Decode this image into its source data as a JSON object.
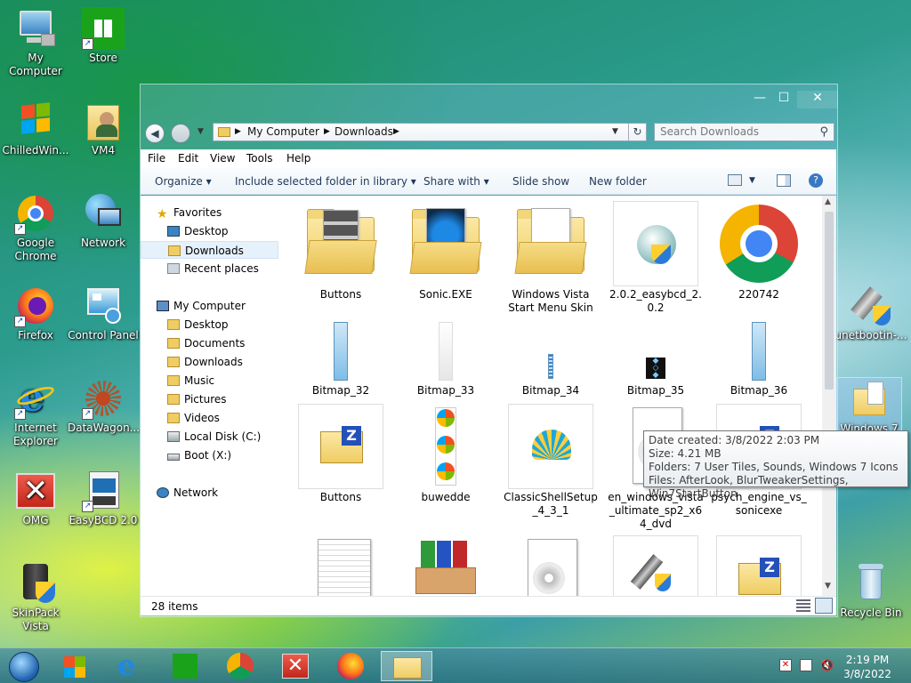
{
  "desktop": {
    "icons": [
      {
        "label": "My Computer",
        "icon": "computer-icon"
      },
      {
        "label": "Store",
        "icon": "store-icon"
      },
      {
        "label": "ChilledWin...",
        "icon": "windows-flag-icon"
      },
      {
        "label": "VM4",
        "icon": "user-folder-icon"
      },
      {
        "label": "Google Chrome",
        "icon": "chrome-icon"
      },
      {
        "label": "Network",
        "icon": "network-icon"
      },
      {
        "label": "Firefox",
        "icon": "firefox-icon"
      },
      {
        "label": "Control Panel",
        "icon": "control-panel-icon"
      },
      {
        "label": "Internet Explorer",
        "icon": "internet-explorer-icon"
      },
      {
        "label": "DataWagon...",
        "icon": "datawagon-icon"
      },
      {
        "label": "OMG",
        "icon": "red-x-icon"
      },
      {
        "label": "EasyBCD 2.0",
        "icon": "easybcd-icon"
      },
      {
        "label": "SkinPack Vista",
        "icon": "skinpack-icon"
      },
      {
        "label": "unetbootin-...",
        "icon": "usb-installer-icon"
      },
      {
        "label": "Windows 7 ...",
        "icon": "folder-icon"
      },
      {
        "label": "Recycle Bin",
        "icon": "recycle-bin-icon"
      }
    ]
  },
  "window": {
    "controls": {
      "minimize": "—",
      "maximize": "☐",
      "close": "✕"
    },
    "breadcrumb": [
      "My Computer",
      "Downloads"
    ],
    "search_placeholder": "Search Downloads",
    "menu": [
      "File",
      "Edit",
      "View",
      "Tools",
      "Help"
    ],
    "commands": [
      "Organize",
      "Include selected folder in library",
      "Share with",
      "Slide show",
      "New folder"
    ],
    "nav": {
      "favorites_header": "Favorites",
      "favorites": [
        "Desktop",
        "Downloads",
        "Recent places"
      ],
      "computer_header": "My Computer",
      "computer": [
        "Desktop",
        "Documents",
        "Downloads",
        "Music",
        "Pictures",
        "Videos",
        "Local Disk (C:)",
        "Boot (X:)"
      ],
      "network_header": "Network"
    },
    "items": [
      "Buttons",
      "Sonic.EXE",
      "Windows Vista Start Menu Skin",
      "2.0.2_easybcd_2.0.2",
      "220742",
      "Bitmap_32",
      "Bitmap_33",
      "Bitmap_34",
      "Bitmap_35",
      "Bitmap_36",
      "Buttons",
      "buwedde",
      "ClassicShellSetup_4_3_1",
      "en_windows_vista_ultimate_sp2_x64_dvd",
      "psych_engine_vs_sonicexe"
    ],
    "status": "28 items",
    "tooltip": {
      "created": "Date created: 3/8/2022 2:03 PM",
      "size": "Size: 4.21 MB",
      "folders": "Folders: 7 User Tiles, Sounds, Windows 7 Icons",
      "files": "Files: AfterLook, BlurTweakerSettings, Win7StartButton"
    }
  },
  "taskbar": {
    "time": "2:19 PM",
    "date": "3/8/2022"
  }
}
